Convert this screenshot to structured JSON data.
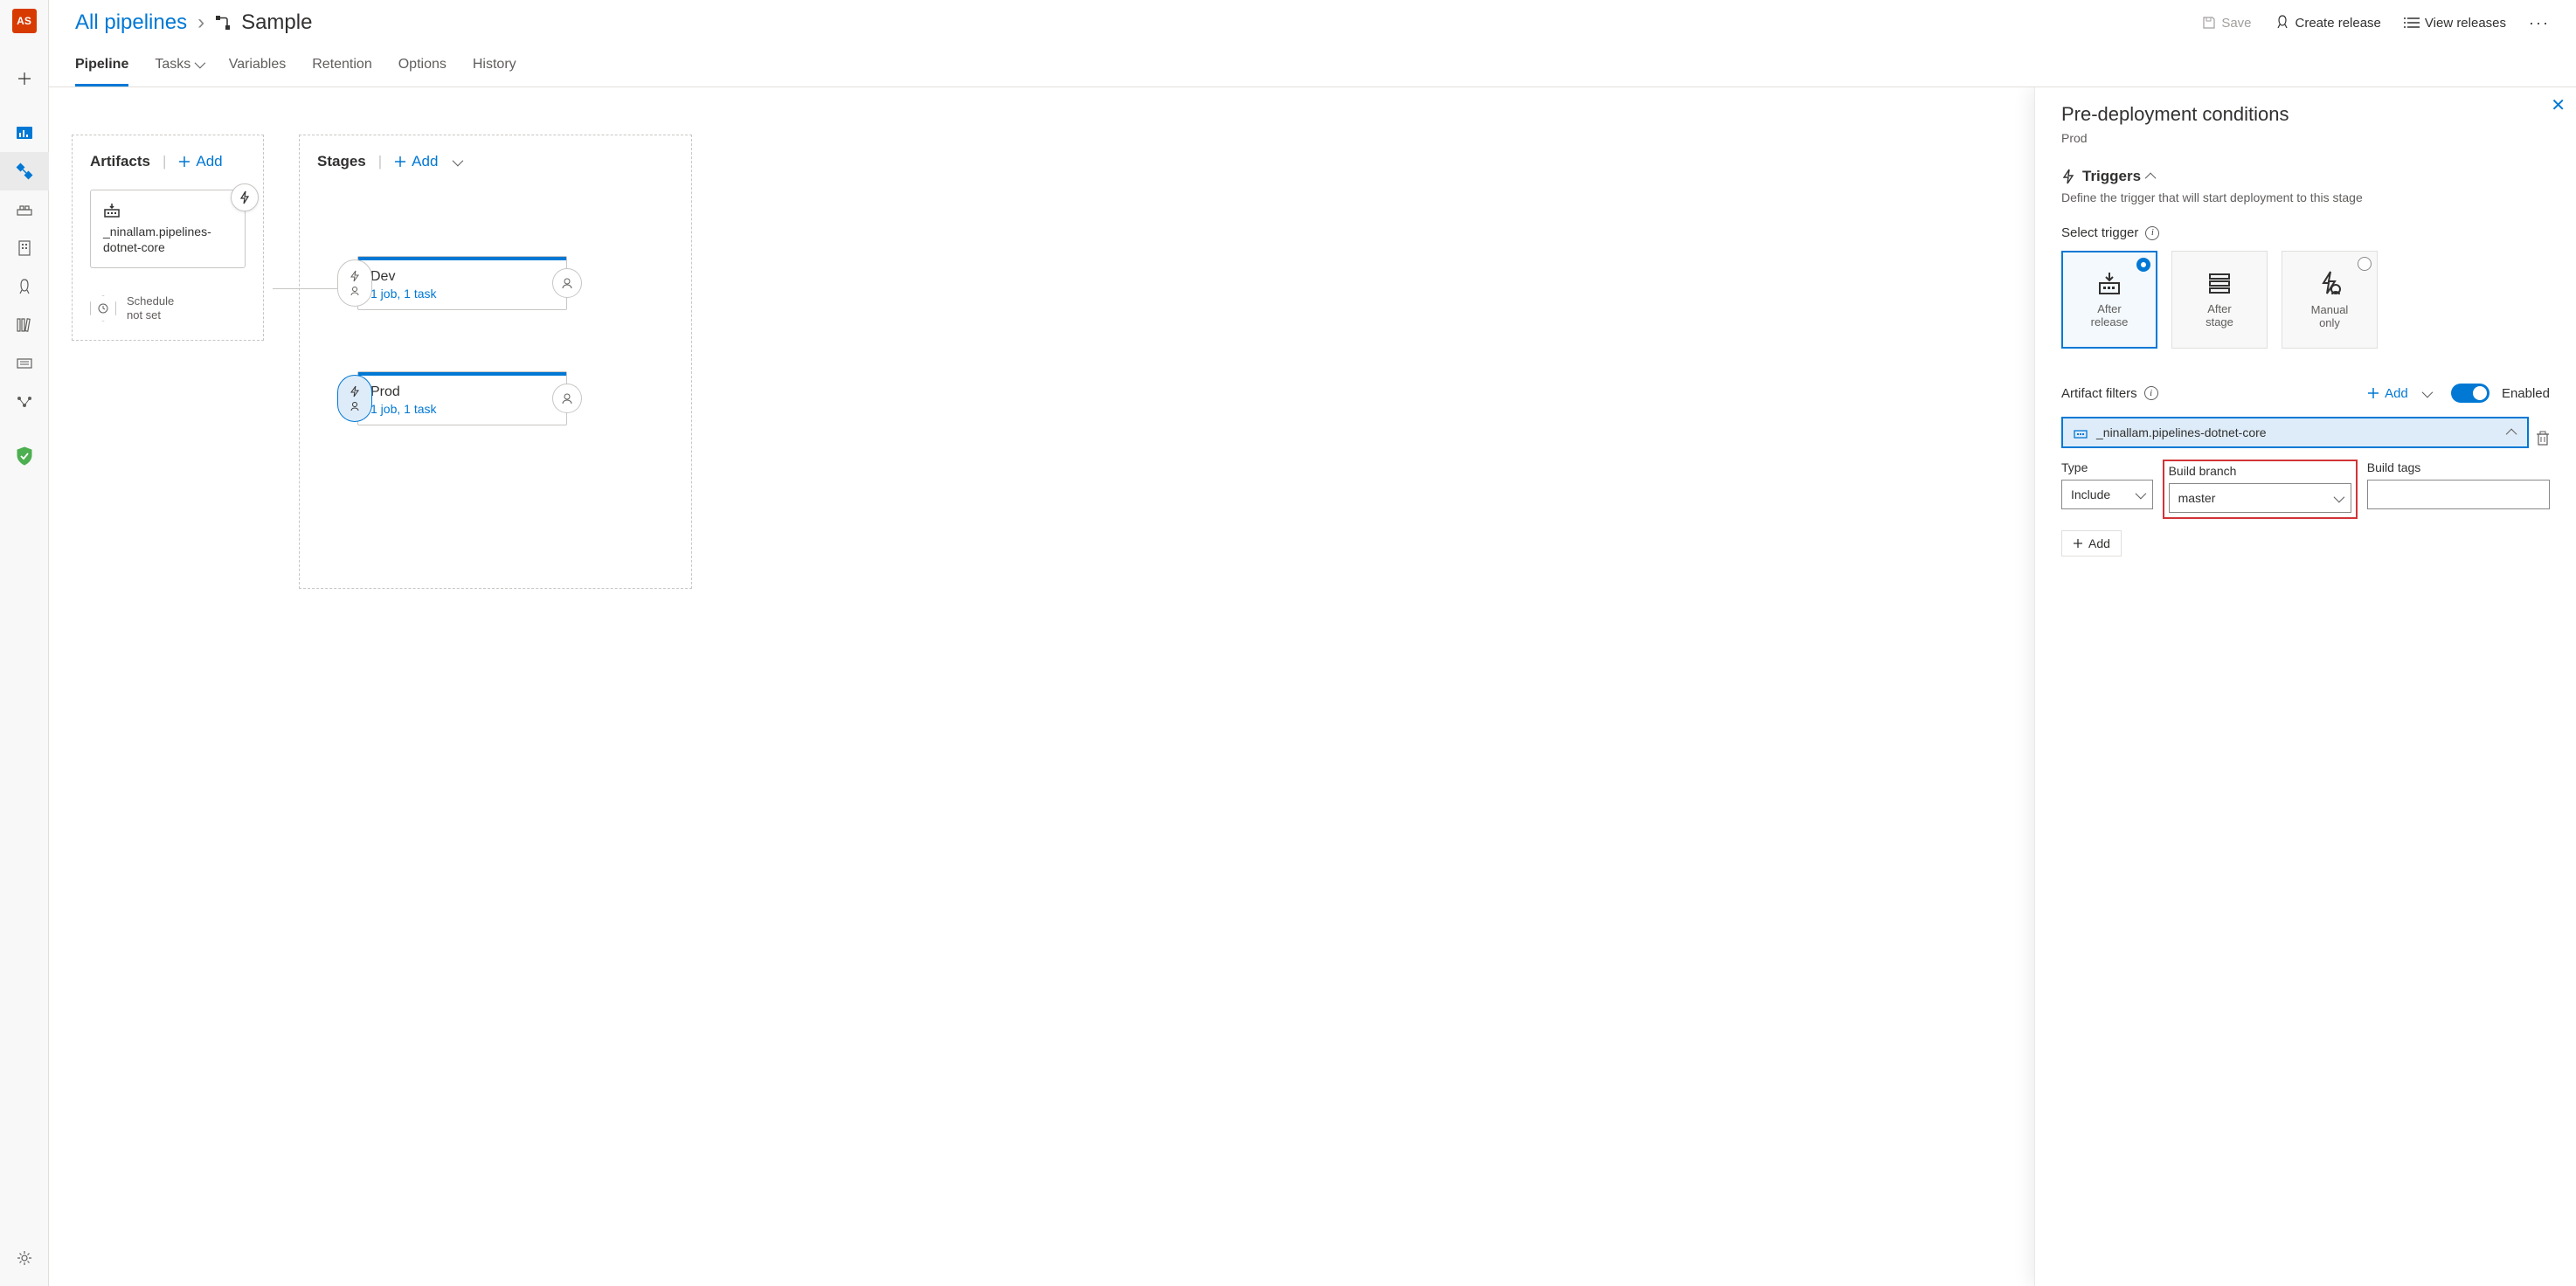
{
  "rail": {
    "avatar": "AS"
  },
  "breadcrumb": {
    "root": "All pipelines",
    "current": "Sample"
  },
  "header_actions": {
    "save": "Save",
    "create_release": "Create release",
    "view_releases": "View releases"
  },
  "tabs": {
    "pipeline": "Pipeline",
    "tasks": "Tasks",
    "variables": "Variables",
    "retention": "Retention",
    "options": "Options",
    "history": "History"
  },
  "artifacts": {
    "title": "Artifacts",
    "add": "Add",
    "card_name": "_ninallam.pipelines-dotnet-core",
    "schedule_l1": "Schedule",
    "schedule_l2": "not set"
  },
  "stages": {
    "title": "Stages",
    "add": "Add",
    "items": [
      {
        "name": "Dev",
        "sub": "1 job, 1 task"
      },
      {
        "name": "Prod",
        "sub": "1 job, 1 task"
      }
    ]
  },
  "panel": {
    "title": "Pre-deployment conditions",
    "stage": "Prod",
    "triggers_heading": "Triggers",
    "triggers_desc": "Define the trigger that will start deployment to this stage",
    "select_trigger": "Select trigger",
    "trigger_opts": {
      "after_release_l1": "After",
      "after_release_l2": "release",
      "after_stage_l1": "After",
      "after_stage_l2": "stage",
      "manual_l1": "Manual",
      "manual_l2": "only"
    },
    "artifact_filters": "Artifact filters",
    "add": "Add",
    "enabled": "Enabled",
    "artifact_name": "_ninallam.pipelines-dotnet-core",
    "col_type": "Type",
    "col_branch": "Build branch",
    "col_tags": "Build tags",
    "type_value": "Include",
    "branch_value": "master",
    "add_row": "Add"
  }
}
